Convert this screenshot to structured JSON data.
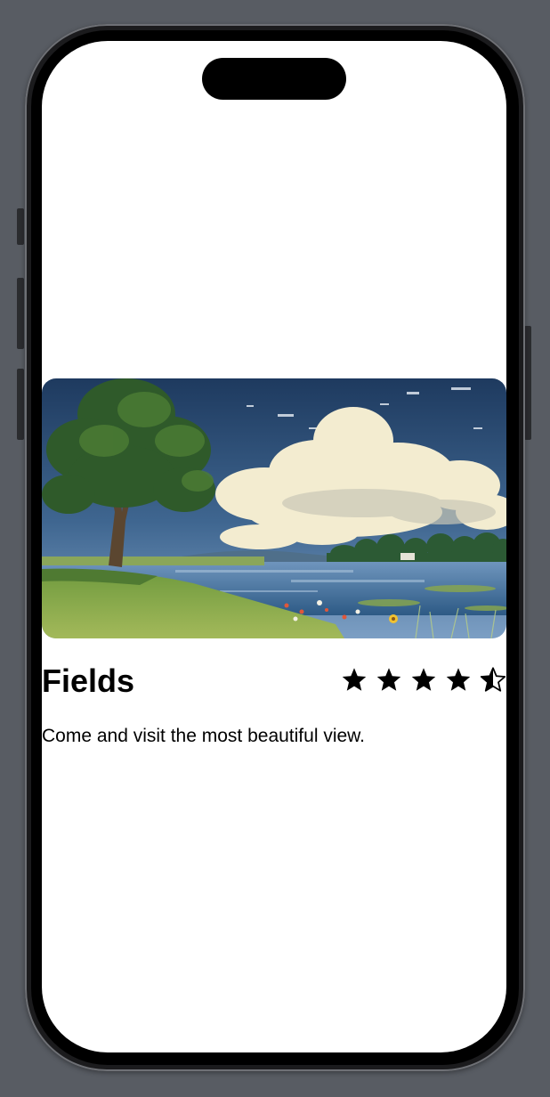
{
  "card": {
    "title": "Fields",
    "description": "Come and visit the most beautiful view.",
    "rating": 4.5,
    "rating_max": 5
  },
  "image": {
    "subject": "tree by a lake with clouds",
    "colors": {
      "sky_top": "#1e3a5f",
      "sky_bottom": "#5f86b0",
      "cloud": "#f3ecd0",
      "water": "#3b6b96",
      "grass": "#7fa14a",
      "foliage": "#2f5a2a"
    }
  }
}
